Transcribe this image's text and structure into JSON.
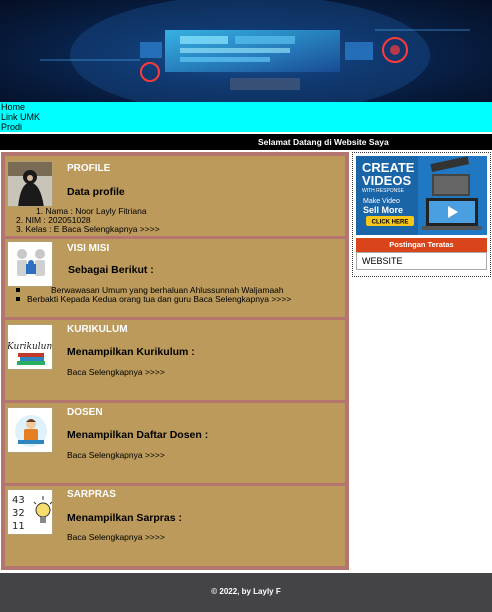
{
  "nav": {
    "items": [
      {
        "label": "Home"
      },
      {
        "label": "Link UMK"
      },
      {
        "label": "Prodi"
      }
    ]
  },
  "welcome": "Selamat Datang di Website Saya",
  "sections": [
    {
      "heading": "PROFILE",
      "subheading": "Data profile",
      "icon": "person-photo",
      "lines": [
        "1. Nama : Noor Layly Fitriana",
        "2. NIM : 202051028",
        "3. Kelas : E Baca Selengkapnya >>>>"
      ]
    },
    {
      "heading": "VISI MISI",
      "subheading": "Sebagai Berikut :",
      "icon": "puzzle-people-icon",
      "bullets": [
        "Berwawasan Umum yang berhaluan Ahlussunnah Waljamaah",
        "Berbakti Kepada Kedua orang tua dan guru Baca Selengkapnya >>>>"
      ]
    },
    {
      "heading": "KURIKULUM",
      "subheading": "Menampilkan Kurikulum :",
      "icon": "kurikulum-icon",
      "icon_text": "Kurikulum",
      "link": "Baca Selengkapnya >>>>"
    },
    {
      "heading": "DOSEN",
      "subheading": "Menampilkan Daftar Dosen :",
      "icon": "teacher-icon",
      "link": "Baca Selengkapnya >>>>"
    },
    {
      "heading": "SARPRAS",
      "subheading": "Menampilkan Sarpras :",
      "icon": "numbers-bulb-icon",
      "icon_numbers": [
        "43",
        "32",
        "11"
      ],
      "link": "Baca Selengkapnya >>>>"
    }
  ],
  "sidebar": {
    "ad": {
      "line1": "CREATE",
      "line2": "VIDEOS",
      "line3": "WITH RESPONSE",
      "line4": "Make Video",
      "line5": "Sell More",
      "button": "CLICK HERE"
    },
    "posts_header": "Postingan Teratas",
    "posts": [
      "WEBSITE"
    ]
  },
  "footer": "© 2022, by Layly F",
  "colors": {
    "nav_bg": "#00ffff",
    "section_bg": "#bb9a5b",
    "section_border": "#b4756f",
    "posts_header_bg": "#d9441b",
    "footer_bg": "#444447"
  }
}
